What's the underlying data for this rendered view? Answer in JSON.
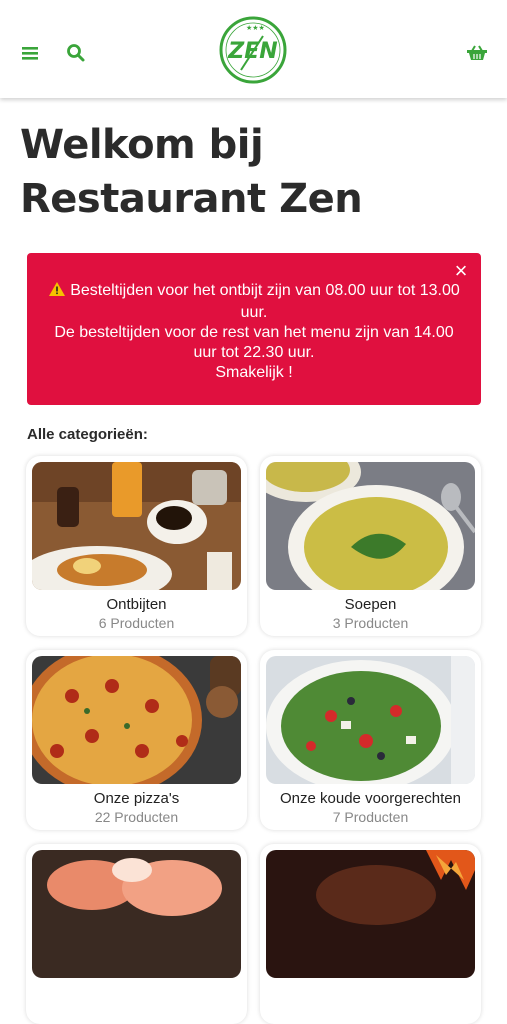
{
  "header": {
    "menu_icon": "hamburger-menu-icon",
    "search_icon": "search-icon",
    "cart_icon": "shopping-basket-icon",
    "logo_text": "ZEN",
    "brand_color": "#3aa53a"
  },
  "page": {
    "title": "Welkom bij Restaurant Zen"
  },
  "alert": {
    "line1": "Besteltijden voor het ontbijt zijn van 08.00 uur tot 13.00 uur.",
    "line2": "De besteltijden voor de rest van het menu zijn van 14.00 uur tot 22.30 uur.",
    "line3": "Smakelijk !",
    "close_label": "×",
    "background": "#e0103f"
  },
  "categories": {
    "heading": "Alle categorieën:",
    "items": [
      {
        "name": "Ontbijten",
        "count": "6 Producten"
      },
      {
        "name": "Soepen",
        "count": "3 Producten"
      },
      {
        "name": "Onze pizza's",
        "count": "22 Producten"
      },
      {
        "name": "Onze koude voorgerechten",
        "count": "7 Producten"
      },
      {
        "name": "",
        "count": ""
      },
      {
        "name": "",
        "count": ""
      }
    ]
  }
}
